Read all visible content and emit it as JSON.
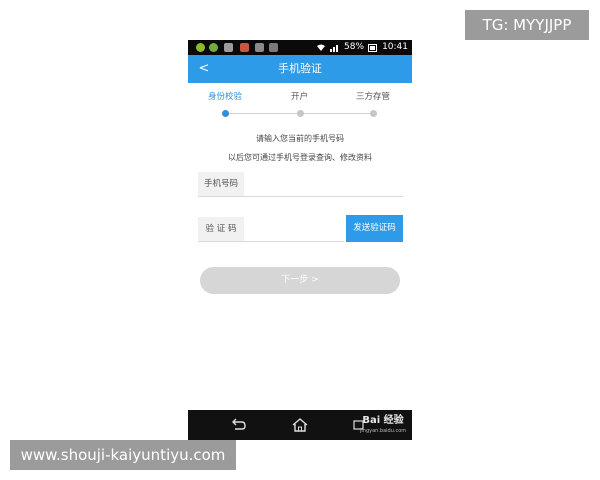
{
  "overlays": {
    "top_watermark": "TG: MYYJJPP",
    "bottom_watermark": "www.shouji-kaiyuntiyu.com"
  },
  "status_bar": {
    "battery": "58%",
    "time": "10:41",
    "icons": [
      "wechat-icon",
      "wechat-icon",
      "image-icon",
      "app-icon",
      "facebook-icon",
      "image-icon",
      "wifi-icon",
      "signal-icon",
      "battery-icon"
    ]
  },
  "header": {
    "back_label": "<",
    "title": "手机验证"
  },
  "steps": [
    {
      "label": "身份校验",
      "active": true
    },
    {
      "label": "开户",
      "active": false
    },
    {
      "label": "三方存管",
      "active": false
    }
  ],
  "instructions": {
    "line1": "请输入您当前的手机号码",
    "line2": "以后您可通过手机号登录查询、修改资料"
  },
  "form": {
    "phone_label": "手机号码",
    "phone_value": "",
    "code_label": "验 证 码",
    "code_value": "",
    "send_code_label": "发送验证码",
    "next_label": "下一步 >"
  },
  "nav_bar": {
    "baidu_logo": "Bai 经验",
    "baidu_url": "jingyan.baidu.com"
  },
  "colors": {
    "primary": "#2d9be8",
    "active_step": "#2d8fd8",
    "disabled_button": "#d6d6d6",
    "status_bar": "#0a0a0a",
    "nav_bar": "#111111"
  }
}
